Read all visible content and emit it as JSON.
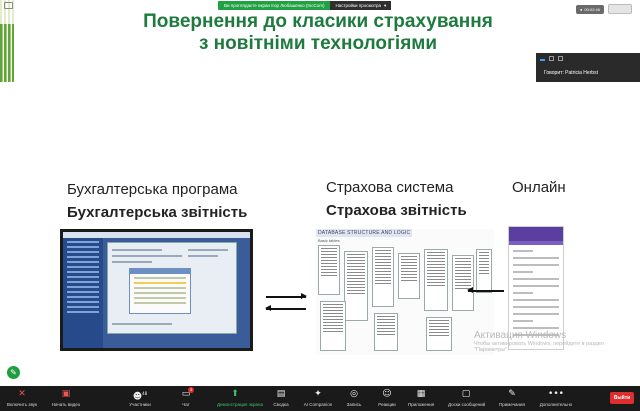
{
  "share_banner": {
    "viewing_text": "Ви проглядаєте екран Ігор Любашенко (IncCom)",
    "settings_label": "Настройки просмотра"
  },
  "top_right": {
    "recording_time": "00:02:46"
  },
  "slide": {
    "title_line1": "Повернення до класики страхування",
    "title_line2": "з новітніми технологіями",
    "col1_heading": "Бухгалтерська програма",
    "col1_bold": "Бухгалтерська звітність",
    "col2_heading": "Страхова система",
    "col2_bold": "Страхова звітність",
    "col3_heading": "Онлайн",
    "db_title": "DATABASE STRUCTURE AND LOGIC",
    "db_subtitle": "Basic tables"
  },
  "speaker_panel": {
    "speaking_text": "Говорит: Patricia Herbst"
  },
  "watermark": {
    "title": "Активация Windows",
    "line1": "Чтобы активировать Windows, перейдите в раздел",
    "line2": "\"Параметры\"."
  },
  "toolbar": {
    "items": [
      {
        "label": "Включить звук",
        "icon": "muted-mic-icon"
      },
      {
        "label": "Начать видео",
        "icon": "video-off-icon"
      },
      {
        "label": "Участники",
        "icon": "participants-icon",
        "count": "48"
      },
      {
        "label": "Чат",
        "icon": "chat-icon",
        "badge": "3"
      },
      {
        "label": "Демонстрация экрана",
        "icon": "share-screen-icon"
      },
      {
        "label": "Сводка",
        "icon": "summary-icon"
      },
      {
        "label": "AI Companion",
        "icon": "ai-companion-icon"
      },
      {
        "label": "Запись",
        "icon": "record-icon"
      },
      {
        "label": "Реакции",
        "icon": "reactions-icon"
      },
      {
        "label": "Приложения",
        "icon": "apps-icon"
      },
      {
        "label": "Доски сообщений",
        "icon": "whiteboards-icon"
      },
      {
        "label": "Примечания",
        "icon": "notes-icon"
      },
      {
        "label": "Дополнительно",
        "icon": "more-icon"
      }
    ],
    "leave_label": "Выйти"
  }
}
